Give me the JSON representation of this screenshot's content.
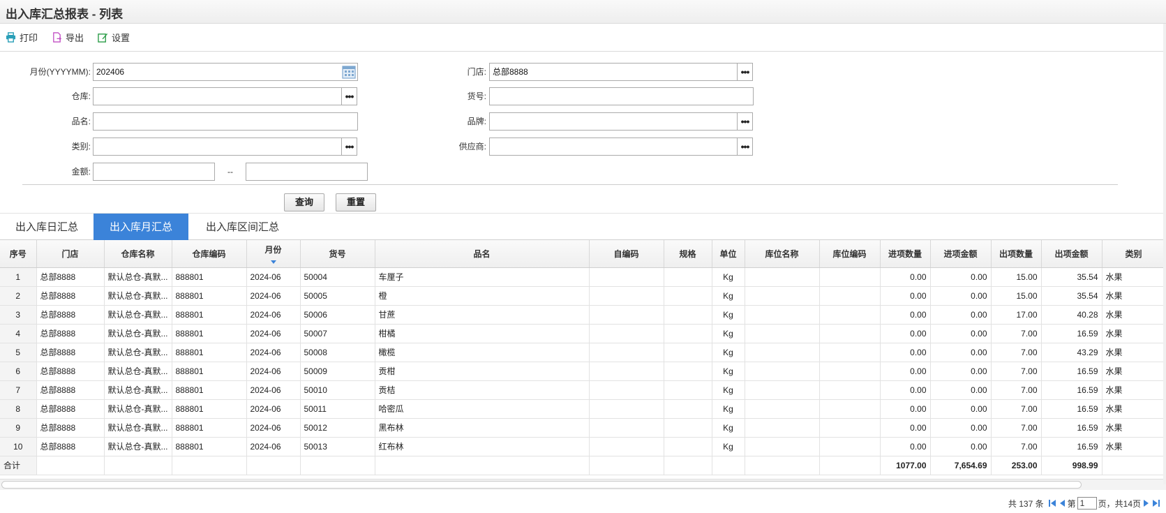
{
  "title": "出入库汇总报表 - 列表",
  "toolbar": {
    "print": "打印",
    "export": "导出",
    "settings": "设置"
  },
  "form": {
    "month_label": "月份(YYYYMM):",
    "month_value": "202406",
    "store_label": "门店:",
    "store_value": "总部8888",
    "warehouse_label": "仓库:",
    "warehouse_value": "",
    "goods_no_label": "货号:",
    "goods_no_value": "",
    "name_label": "品名:",
    "name_value": "",
    "brand_label": "品牌:",
    "brand_value": "",
    "category_label": "类别:",
    "category_value": "",
    "supplier_label": "供应商:",
    "supplier_value": "",
    "amount_label": "金额:",
    "amount_from": "",
    "amount_sep": "--",
    "amount_to": "",
    "query_button": "查询",
    "reset_button": "重置"
  },
  "tabs": [
    {
      "label": "出入库日汇总",
      "active": false
    },
    {
      "label": "出入库月汇总",
      "active": true
    },
    {
      "label": "出入库区间汇总",
      "active": false
    }
  ],
  "columns": [
    "序号",
    "门店",
    "仓库名称",
    "仓库编码",
    "月份",
    "货号",
    "品名",
    "自编码",
    "规格",
    "单位",
    "库位名称",
    "库位编码",
    "进项数量",
    "进项金额",
    "出项数量",
    "出项金额",
    "类别"
  ],
  "rows": [
    [
      "1",
      "总部8888",
      "默认总仓-真默...",
      "888801",
      "2024-06",
      "50004",
      "车厘子",
      "",
      "",
      "Kg",
      "",
      "",
      "0.00",
      "0.00",
      "15.00",
      "35.54",
      "水果"
    ],
    [
      "2",
      "总部8888",
      "默认总仓-真默...",
      "888801",
      "2024-06",
      "50005",
      "橙",
      "",
      "",
      "Kg",
      "",
      "",
      "0.00",
      "0.00",
      "15.00",
      "35.54",
      "水果"
    ],
    [
      "3",
      "总部8888",
      "默认总仓-真默...",
      "888801",
      "2024-06",
      "50006",
      "甘蔗",
      "",
      "",
      "Kg",
      "",
      "",
      "0.00",
      "0.00",
      "17.00",
      "40.28",
      "水果"
    ],
    [
      "4",
      "总部8888",
      "默认总仓-真默...",
      "888801",
      "2024-06",
      "50007",
      "柑橘",
      "",
      "",
      "Kg",
      "",
      "",
      "0.00",
      "0.00",
      "7.00",
      "16.59",
      "水果"
    ],
    [
      "5",
      "总部8888",
      "默认总仓-真默...",
      "888801",
      "2024-06",
      "50008",
      "橄榄",
      "",
      "",
      "Kg",
      "",
      "",
      "0.00",
      "0.00",
      "7.00",
      "43.29",
      "水果"
    ],
    [
      "6",
      "总部8888",
      "默认总仓-真默...",
      "888801",
      "2024-06",
      "50009",
      "贡柑",
      "",
      "",
      "Kg",
      "",
      "",
      "0.00",
      "0.00",
      "7.00",
      "16.59",
      "水果"
    ],
    [
      "7",
      "总部8888",
      "默认总仓-真默...",
      "888801",
      "2024-06",
      "50010",
      "贡桔",
      "",
      "",
      "Kg",
      "",
      "",
      "0.00",
      "0.00",
      "7.00",
      "16.59",
      "水果"
    ],
    [
      "8",
      "总部8888",
      "默认总仓-真默...",
      "888801",
      "2024-06",
      "50011",
      "哈密瓜",
      "",
      "",
      "Kg",
      "",
      "",
      "0.00",
      "0.00",
      "7.00",
      "16.59",
      "水果"
    ],
    [
      "9",
      "总部8888",
      "默认总仓-真默...",
      "888801",
      "2024-06",
      "50012",
      "黑布林",
      "",
      "",
      "Kg",
      "",
      "",
      "0.00",
      "0.00",
      "7.00",
      "16.59",
      "水果"
    ],
    [
      "10",
      "总部8888",
      "默认总仓-真默...",
      "888801",
      "2024-06",
      "50013",
      "红布林",
      "",
      "",
      "Kg",
      "",
      "",
      "0.00",
      "0.00",
      "7.00",
      "16.59",
      "水果"
    ]
  ],
  "total": {
    "label": "合计",
    "in_qty": "1077.00",
    "in_amount": "7,654.69",
    "out_qty": "253.00",
    "out_amount": "998.99"
  },
  "pager": {
    "total_text": "共 137 条",
    "page_prefix": "第",
    "page_value": "1",
    "page_suffix": "页，共14页"
  },
  "colors": {
    "accent": "#3b83d9"
  }
}
